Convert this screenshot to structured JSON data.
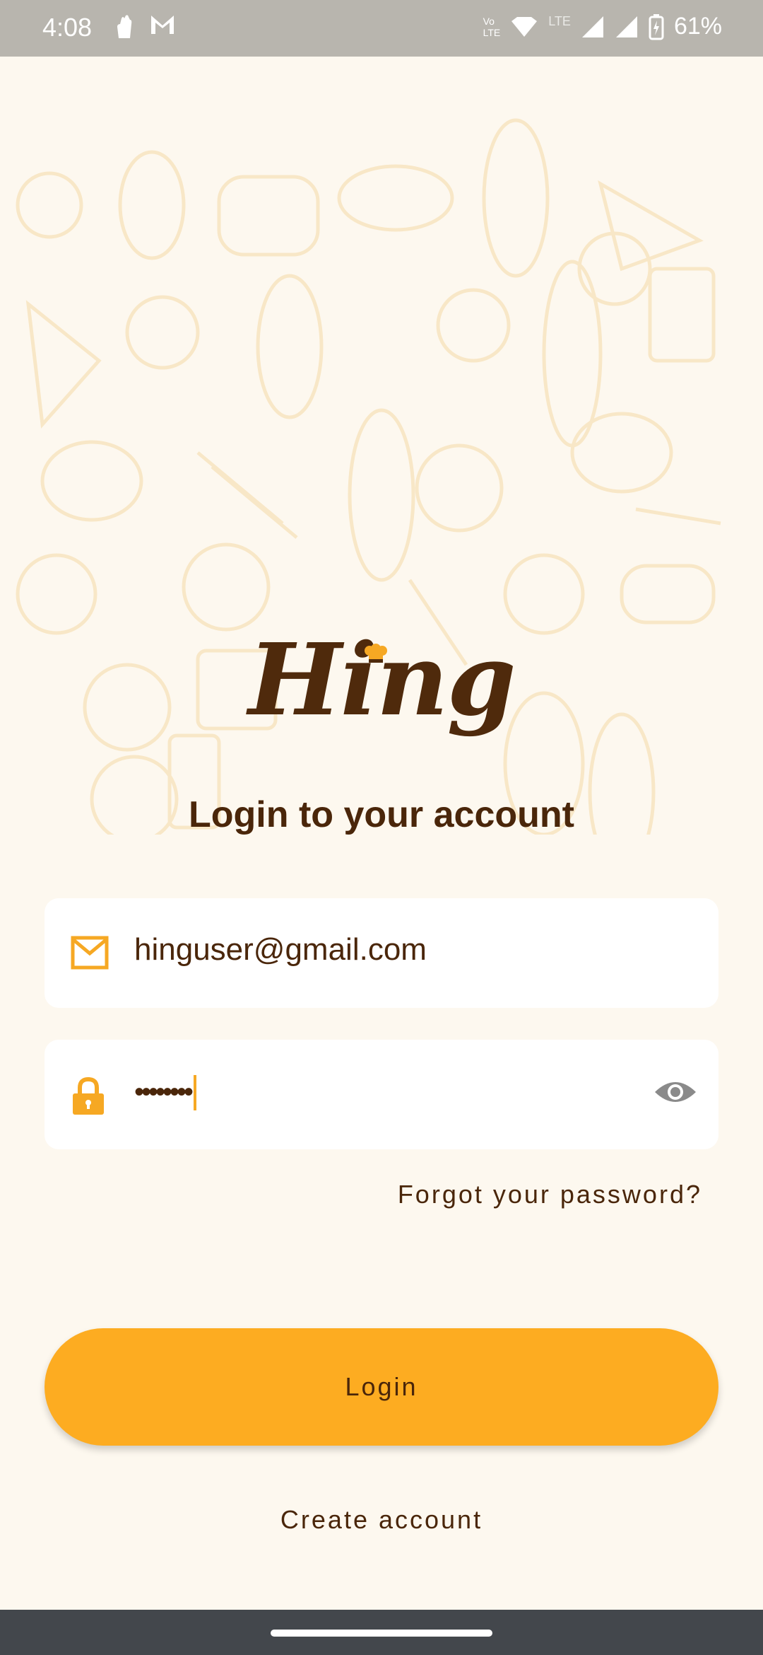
{
  "status_bar": {
    "time": "4:08",
    "battery": "61%",
    "network": "LTE"
  },
  "app": {
    "logo_text": "Hing",
    "title": "Login to your account"
  },
  "form": {
    "email_value": "hinguser@gmail.com",
    "password_value": "••••••••",
    "forgot_label": "Forgot your password?",
    "login_label": "Login",
    "create_label": "Create account"
  },
  "colors": {
    "background": "#fdf8ef",
    "accent": "#fdac21",
    "text_brown": "#4a260a",
    "icon_orange": "#f6a823"
  }
}
